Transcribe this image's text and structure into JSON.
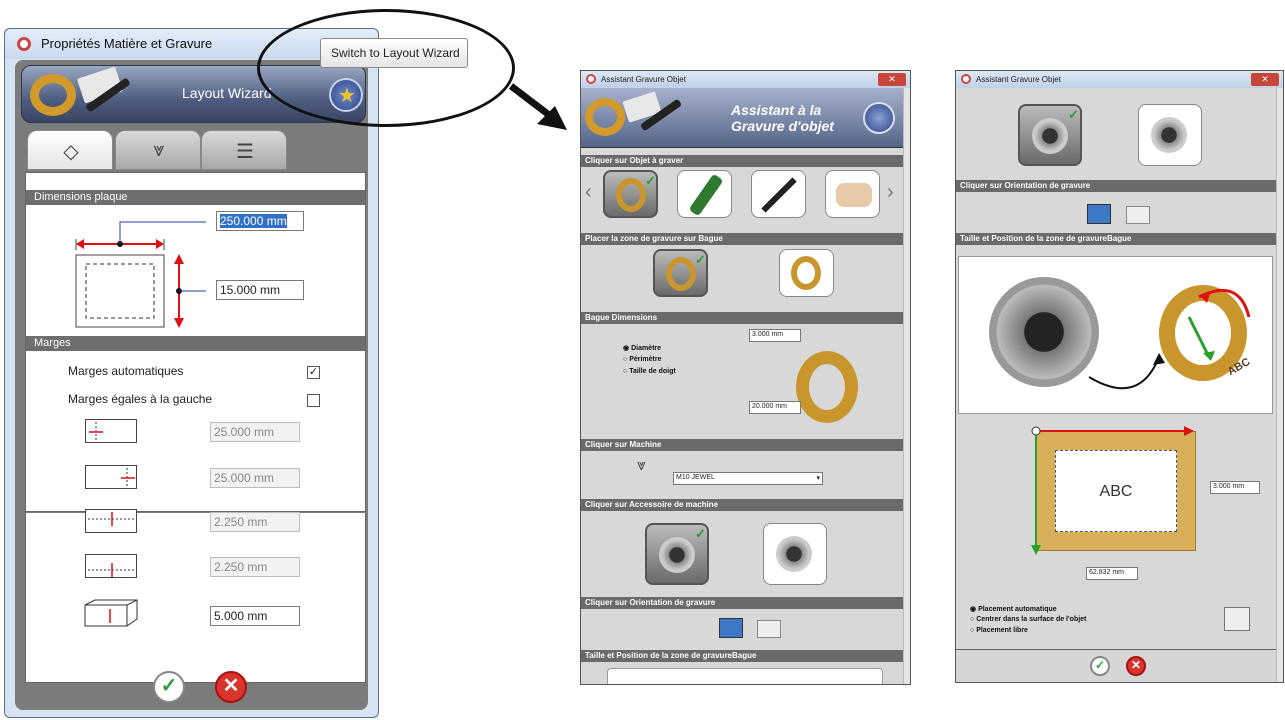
{
  "window1": {
    "title": "Propriétés Matière et Gravure",
    "banner_title": "Layout Wizard",
    "sections": {
      "plate_dimensions": "Dimensions plaque",
      "margins": "Marges"
    },
    "plate": {
      "width_value": "250.000 mm",
      "height_value": "15.000 mm"
    },
    "options": {
      "auto_margins_label": "Marges automatiques",
      "auto_margins_checked": true,
      "equal_margins_label": "Marges égales à la gauche",
      "equal_margins_checked": false
    },
    "margin_values": [
      "25.000 mm",
      "25.000 mm",
      "2.250 mm",
      "2.250 mm",
      "5.000 mm"
    ],
    "ok_icon": "checkmark-icon",
    "cancel_icon": "cross-icon"
  },
  "tooltip": {
    "text": "Switch to Layout Wizard"
  },
  "window2": {
    "title": "Assistant Gravure Objet",
    "banner_title_line1": "Assistant à la",
    "banner_title_line2": "Gravure d'objet",
    "sections": {
      "object": "Cliquer sur Objet à graver",
      "zone": "Placer la zone de gravure sur Bague",
      "dimensions": "Bague Dimensions",
      "machine": "Cliquer sur Machine",
      "accessory": "Cliquer sur Accessoire de machine",
      "orientation": "Cliquer sur Orientation de gravure",
      "size_position": "Taille et Position de la zone de gravureBague"
    },
    "ring_options": [
      "Diamètre",
      "Périmètre",
      "Taille de doigt"
    ],
    "ring_selected": "Diamètre",
    "ring_width": "3.000 mm",
    "ring_height": "20.000 mm",
    "machine_value": "M10 JEWEL"
  },
  "window3": {
    "title": "Assistant Gravure Objet",
    "sections": {
      "orientation": "Cliquer sur Orientation de gravure",
      "size_position": "Taille et Position de la zone de gravureBague"
    },
    "preview_text": "ABC",
    "zone_height": "3.000 mm",
    "zone_width": "62.832 mm",
    "placement_options": [
      "Placement automatique",
      "Centrer dans la surface de l'objet",
      "Placement libre"
    ],
    "placement_selected": "Placement automatique"
  }
}
